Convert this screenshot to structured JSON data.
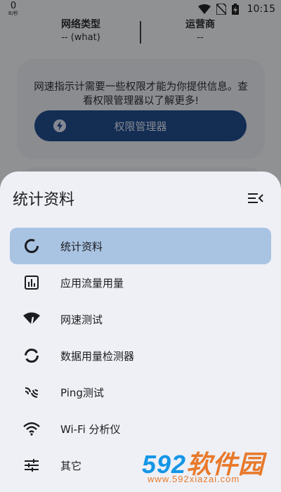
{
  "status_bar": {
    "speed_value": "0",
    "speed_unit": "B/秒",
    "time": "10:15"
  },
  "background": {
    "network_type_label": "网络类型",
    "network_type_value": "-- (what)",
    "carrier_label": "运营商",
    "carrier_value": "--",
    "permission_text": "网速指示计需要一些权限才能为你提供信息。查看权限管理器以了解更多!",
    "permission_button": "权限管理器"
  },
  "sheet": {
    "title": "统计资料",
    "items": [
      {
        "label": "统计资料",
        "icon": "donut-icon",
        "selected": true
      },
      {
        "label": "应用流量用量",
        "icon": "bar-chart-icon",
        "selected": false
      },
      {
        "label": "网速测试",
        "icon": "speed-wifi-icon",
        "selected": false
      },
      {
        "label": "数据用量检测器",
        "icon": "data-usage-icon",
        "selected": false
      },
      {
        "label": "Ping测试",
        "icon": "ping-icon",
        "selected": false
      },
      {
        "label": "Wi-Fi 分析仪",
        "icon": "wifi-icon",
        "selected": false
      },
      {
        "label": "其它",
        "icon": "tune-icon",
        "selected": false
      }
    ]
  },
  "watermark": {
    "logo_number": "592",
    "logo_text": "软件园",
    "url": "www.592xiazai.com"
  },
  "colors": {
    "selected_item_bg": "#a9c3e2",
    "button_bg": "#1f4a86",
    "sheet_bg": "#eef0f6",
    "watermark_blue": "#1596e6",
    "watermark_orange": "#e8792a"
  }
}
